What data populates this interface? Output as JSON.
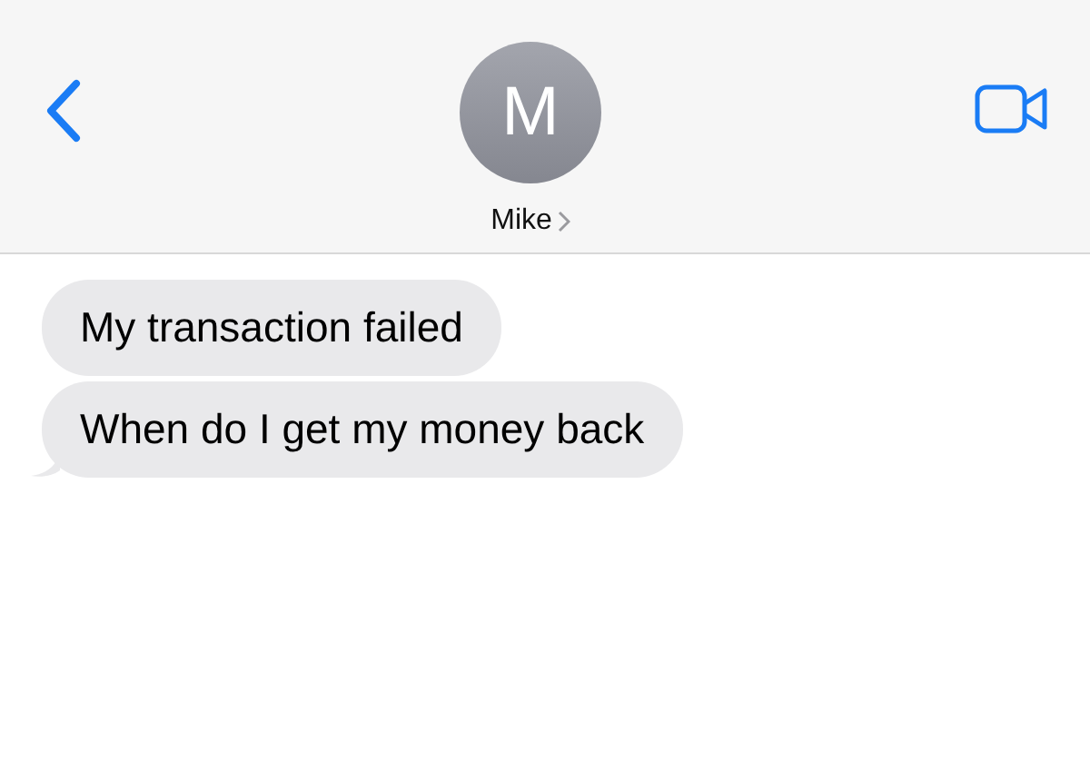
{
  "header": {
    "avatar_initial": "M",
    "contact_name": "Mike"
  },
  "messages": [
    {
      "text": "My transaction failed",
      "tail": false
    },
    {
      "text": "When do I get my money back",
      "tail": true
    }
  ]
}
